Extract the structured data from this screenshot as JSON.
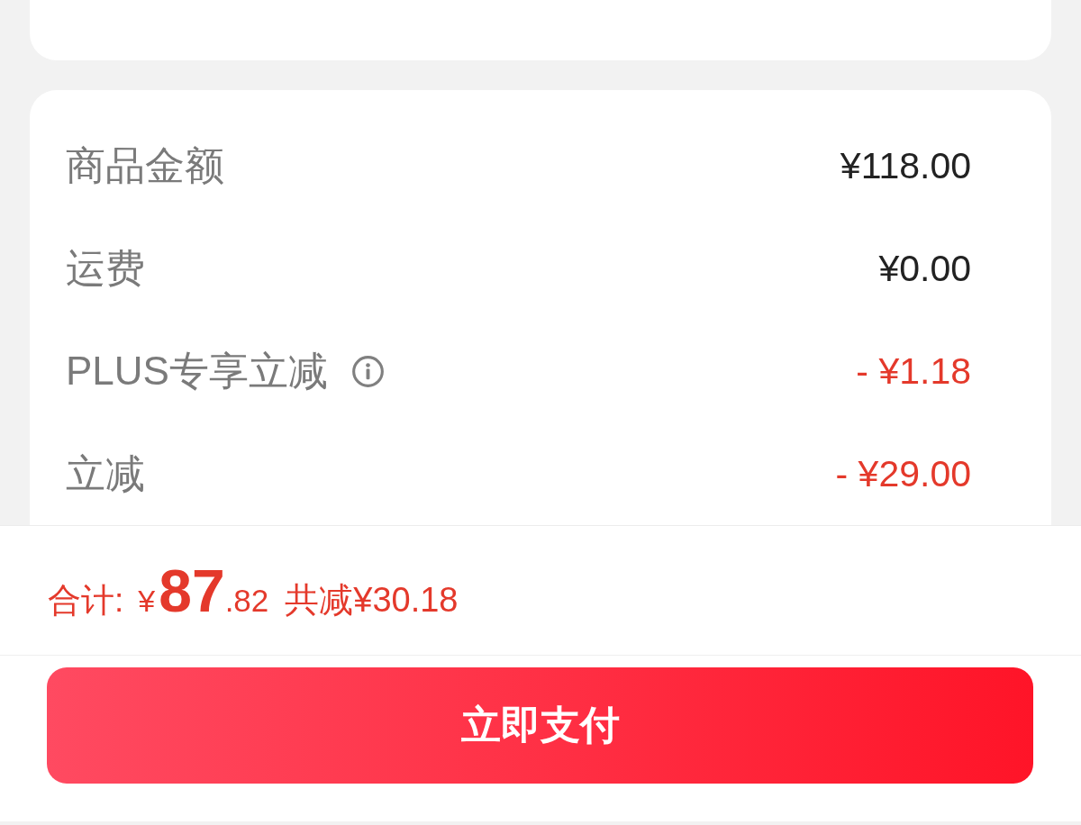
{
  "summary": {
    "rows": [
      {
        "label": "商品金额",
        "value": "¥118.00",
        "kind": "amount"
      },
      {
        "label": "运费",
        "value": "¥0.00",
        "kind": "amount"
      },
      {
        "label": "PLUS专享立减",
        "value": "- ¥1.18",
        "kind": "discount",
        "info_icon": true
      },
      {
        "label": "立减",
        "value": "- ¥29.00",
        "kind": "discount"
      }
    ]
  },
  "footer": {
    "total_label": "合计:",
    "total": {
      "currency": "¥",
      "integer": "87",
      "decimal": ".82"
    },
    "savings": "共减¥30.18"
  },
  "pay_button": {
    "label": "立即支付"
  }
}
